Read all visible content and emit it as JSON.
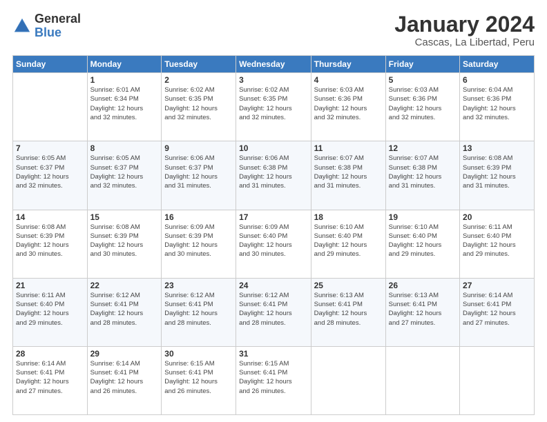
{
  "logo": {
    "general": "General",
    "blue": "Blue"
  },
  "title": "January 2024",
  "location": "Cascas, La Libertad, Peru",
  "days_header": [
    "Sunday",
    "Monday",
    "Tuesday",
    "Wednesday",
    "Thursday",
    "Friday",
    "Saturday"
  ],
  "weeks": [
    [
      {
        "day": "",
        "sunrise": "",
        "sunset": "",
        "daylight": ""
      },
      {
        "day": "1",
        "sunrise": "Sunrise: 6:01 AM",
        "sunset": "Sunset: 6:34 PM",
        "daylight": "Daylight: 12 hours and 32 minutes."
      },
      {
        "day": "2",
        "sunrise": "Sunrise: 6:02 AM",
        "sunset": "Sunset: 6:35 PM",
        "daylight": "Daylight: 12 hours and 32 minutes."
      },
      {
        "day": "3",
        "sunrise": "Sunrise: 6:02 AM",
        "sunset": "Sunset: 6:35 PM",
        "daylight": "Daylight: 12 hours and 32 minutes."
      },
      {
        "day": "4",
        "sunrise": "Sunrise: 6:03 AM",
        "sunset": "Sunset: 6:36 PM",
        "daylight": "Daylight: 12 hours and 32 minutes."
      },
      {
        "day": "5",
        "sunrise": "Sunrise: 6:03 AM",
        "sunset": "Sunset: 6:36 PM",
        "daylight": "Daylight: 12 hours and 32 minutes."
      },
      {
        "day": "6",
        "sunrise": "Sunrise: 6:04 AM",
        "sunset": "Sunset: 6:36 PM",
        "daylight": "Daylight: 12 hours and 32 minutes."
      }
    ],
    [
      {
        "day": "7",
        "sunrise": "Sunrise: 6:05 AM",
        "sunset": "Sunset: 6:37 PM",
        "daylight": "Daylight: 12 hours and 32 minutes."
      },
      {
        "day": "8",
        "sunrise": "Sunrise: 6:05 AM",
        "sunset": "Sunset: 6:37 PM",
        "daylight": "Daylight: 12 hours and 32 minutes."
      },
      {
        "day": "9",
        "sunrise": "Sunrise: 6:06 AM",
        "sunset": "Sunset: 6:37 PM",
        "daylight": "Daylight: 12 hours and 31 minutes."
      },
      {
        "day": "10",
        "sunrise": "Sunrise: 6:06 AM",
        "sunset": "Sunset: 6:38 PM",
        "daylight": "Daylight: 12 hours and 31 minutes."
      },
      {
        "day": "11",
        "sunrise": "Sunrise: 6:07 AM",
        "sunset": "Sunset: 6:38 PM",
        "daylight": "Daylight: 12 hours and 31 minutes."
      },
      {
        "day": "12",
        "sunrise": "Sunrise: 6:07 AM",
        "sunset": "Sunset: 6:38 PM",
        "daylight": "Daylight: 12 hours and 31 minutes."
      },
      {
        "day": "13",
        "sunrise": "Sunrise: 6:08 AM",
        "sunset": "Sunset: 6:39 PM",
        "daylight": "Daylight: 12 hours and 31 minutes."
      }
    ],
    [
      {
        "day": "14",
        "sunrise": "Sunrise: 6:08 AM",
        "sunset": "Sunset: 6:39 PM",
        "daylight": "Daylight: 12 hours and 30 minutes."
      },
      {
        "day": "15",
        "sunrise": "Sunrise: 6:08 AM",
        "sunset": "Sunset: 6:39 PM",
        "daylight": "Daylight: 12 hours and 30 minutes."
      },
      {
        "day": "16",
        "sunrise": "Sunrise: 6:09 AM",
        "sunset": "Sunset: 6:39 PM",
        "daylight": "Daylight: 12 hours and 30 minutes."
      },
      {
        "day": "17",
        "sunrise": "Sunrise: 6:09 AM",
        "sunset": "Sunset: 6:40 PM",
        "daylight": "Daylight: 12 hours and 30 minutes."
      },
      {
        "day": "18",
        "sunrise": "Sunrise: 6:10 AM",
        "sunset": "Sunset: 6:40 PM",
        "daylight": "Daylight: 12 hours and 29 minutes."
      },
      {
        "day": "19",
        "sunrise": "Sunrise: 6:10 AM",
        "sunset": "Sunset: 6:40 PM",
        "daylight": "Daylight: 12 hours and 29 minutes."
      },
      {
        "day": "20",
        "sunrise": "Sunrise: 6:11 AM",
        "sunset": "Sunset: 6:40 PM",
        "daylight": "Daylight: 12 hours and 29 minutes."
      }
    ],
    [
      {
        "day": "21",
        "sunrise": "Sunrise: 6:11 AM",
        "sunset": "Sunset: 6:40 PM",
        "daylight": "Daylight: 12 hours and 29 minutes."
      },
      {
        "day": "22",
        "sunrise": "Sunrise: 6:12 AM",
        "sunset": "Sunset: 6:41 PM",
        "daylight": "Daylight: 12 hours and 28 minutes."
      },
      {
        "day": "23",
        "sunrise": "Sunrise: 6:12 AM",
        "sunset": "Sunset: 6:41 PM",
        "daylight": "Daylight: 12 hours and 28 minutes."
      },
      {
        "day": "24",
        "sunrise": "Sunrise: 6:12 AM",
        "sunset": "Sunset: 6:41 PM",
        "daylight": "Daylight: 12 hours and 28 minutes."
      },
      {
        "day": "25",
        "sunrise": "Sunrise: 6:13 AM",
        "sunset": "Sunset: 6:41 PM",
        "daylight": "Daylight: 12 hours and 28 minutes."
      },
      {
        "day": "26",
        "sunrise": "Sunrise: 6:13 AM",
        "sunset": "Sunset: 6:41 PM",
        "daylight": "Daylight: 12 hours and 27 minutes."
      },
      {
        "day": "27",
        "sunrise": "Sunrise: 6:14 AM",
        "sunset": "Sunset: 6:41 PM",
        "daylight": "Daylight: 12 hours and 27 minutes."
      }
    ],
    [
      {
        "day": "28",
        "sunrise": "Sunrise: 6:14 AM",
        "sunset": "Sunset: 6:41 PM",
        "daylight": "Daylight: 12 hours and 27 minutes."
      },
      {
        "day": "29",
        "sunrise": "Sunrise: 6:14 AM",
        "sunset": "Sunset: 6:41 PM",
        "daylight": "Daylight: 12 hours and 26 minutes."
      },
      {
        "day": "30",
        "sunrise": "Sunrise: 6:15 AM",
        "sunset": "Sunset: 6:41 PM",
        "daylight": "Daylight: 12 hours and 26 minutes."
      },
      {
        "day": "31",
        "sunrise": "Sunrise: 6:15 AM",
        "sunset": "Sunset: 6:41 PM",
        "daylight": "Daylight: 12 hours and 26 minutes."
      },
      {
        "day": "",
        "sunrise": "",
        "sunset": "",
        "daylight": ""
      },
      {
        "day": "",
        "sunrise": "",
        "sunset": "",
        "daylight": ""
      },
      {
        "day": "",
        "sunrise": "",
        "sunset": "",
        "daylight": ""
      }
    ]
  ]
}
